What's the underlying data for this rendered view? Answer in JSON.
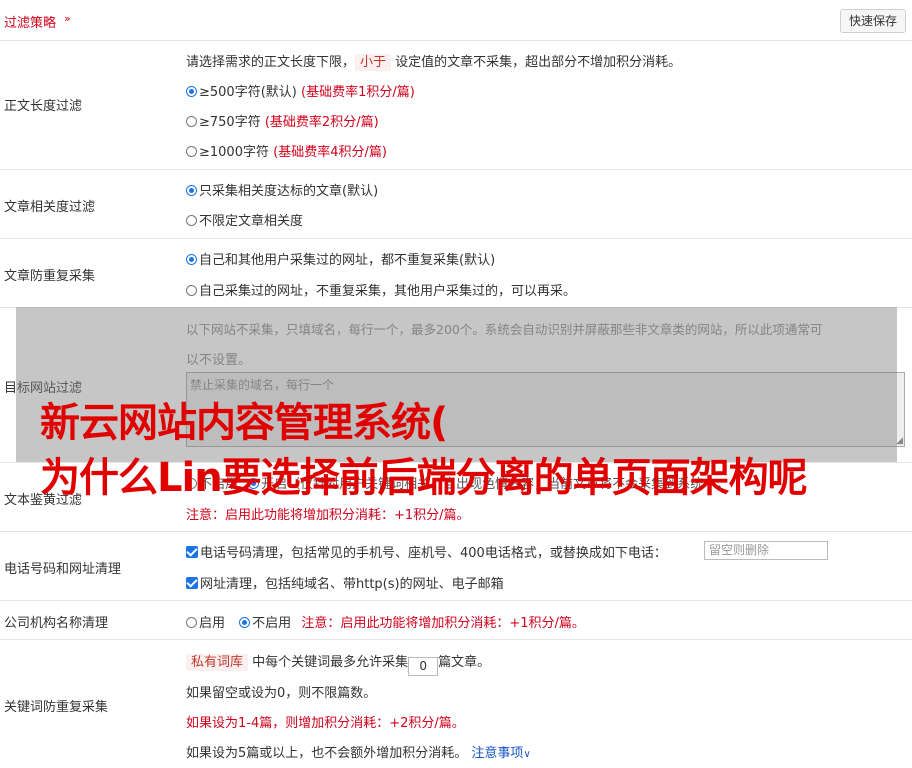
{
  "header": {
    "title": "过滤策略",
    "save_label": "快速保存"
  },
  "length_filter": {
    "label": "正文长度过滤",
    "desc_pre": "请选择需求的正文长度下限，",
    "desc_tag": "小于",
    "desc_post": "设定值的文章不采集，超出部分不增加积分消耗。",
    "options": [
      {
        "text": "≥500字符(默认)",
        "note": "(基础费率1积分/篇)"
      },
      {
        "text": "≥750字符",
        "note": "(基础费率2积分/篇)"
      },
      {
        "text": "≥1000字符",
        "note": "(基础费率4积分/篇)"
      }
    ]
  },
  "relevance": {
    "label": "文章相关度过滤",
    "options": [
      "只采集相关度达标的文章(默认)",
      "不限定文章相关度"
    ]
  },
  "dedup": {
    "label": "文章防重复采集",
    "options": [
      "自己和其他用户采集过的网址，都不重复采集(默认)",
      "自己采集过的网址，不重复采集，其他用户采集过的，可以再采。"
    ]
  },
  "target_site": {
    "label": "目标网站过滤",
    "desc_line1": "以下网站不采集，只填域名，每行一个，最多200个。系统会自动识别并屏蔽那些非文章类的网站，所以此项通常可",
    "desc_line2": "以不设置。",
    "placeholder": "禁止采集的域名，每行一个"
  },
  "watermark": {
    "line1": "新云网站内容管理系统(",
    "line2": "为什么Lin要选择前后端分离的单页面架构呢"
  },
  "porn_filter": {
    "label": "文本鉴黄过滤",
    "opt_off": "不启用",
    "opt_on_text": "开启（仅针对用户关键词相关，当出现色情内容，当前文章将不会采集到系统中；",
    "note": "注意：启用此功能将增加积分消耗：+1积分/篇。"
  },
  "phone_url": {
    "label": "电话号码和网址清理",
    "phone_text": "电话号码清理，包括常见的手机号、座机号、400电话格式，或替换成如下电话：",
    "phone_placeholder": "留空则删除",
    "url_text": "网址清理，包括纯域名、带http(s)的网址、电子邮箱"
  },
  "company": {
    "label": "公司机构名称清理",
    "opt_on": "启用",
    "opt_off": "不启用",
    "note": "注意：启用此功能将增加积分消耗：+1积分/篇。"
  },
  "keyword_dedup": {
    "label": "关键词防重复采集",
    "tag": "私有词库",
    "line1_mid": "中每个关键词最多允许采集",
    "value": "0",
    "line1_post": "篇文章。",
    "line2": "如果留空或设为0，则不限篇数。",
    "line3": "如果设为1-4篇，则增加积分消耗：+2积分/篇。",
    "line4": "如果设为5篇或以上，也不会额外增加积分消耗。",
    "link": "注意事项"
  }
}
